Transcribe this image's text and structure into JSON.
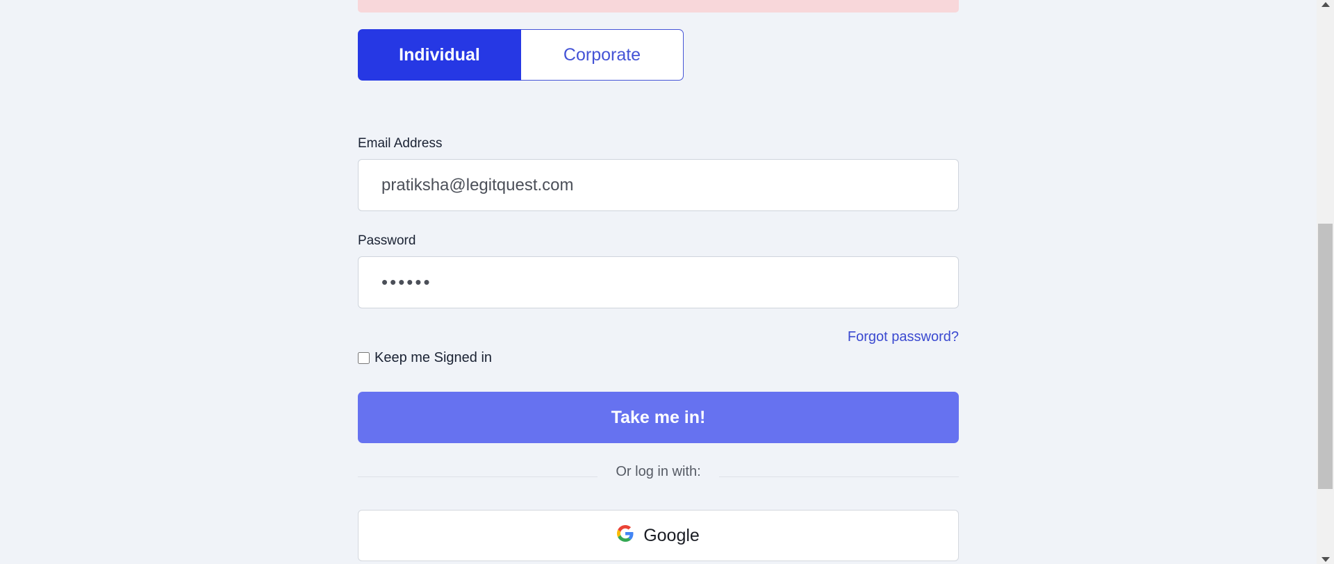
{
  "account_type": {
    "individual_label": "Individual",
    "corporate_label": "Corporate",
    "selected": "Individual"
  },
  "form": {
    "email_label": "Email Address",
    "email_value": "pratiksha@legitquest.com",
    "password_label": "Password",
    "password_value": "••••••",
    "forgot_password": "Forgot password?",
    "keep_signed_in_label": "Keep me Signed in",
    "keep_signed_in_checked": false,
    "submit_label": "Take me in!"
  },
  "social_login": {
    "divider_text": "Or log in with:",
    "google_label": "Google"
  },
  "colors": {
    "primary": "#2638e4",
    "submit": "#6672f0",
    "alert": "#f8d7da",
    "background": "#f0f3f8",
    "link": "#3a49d0"
  }
}
